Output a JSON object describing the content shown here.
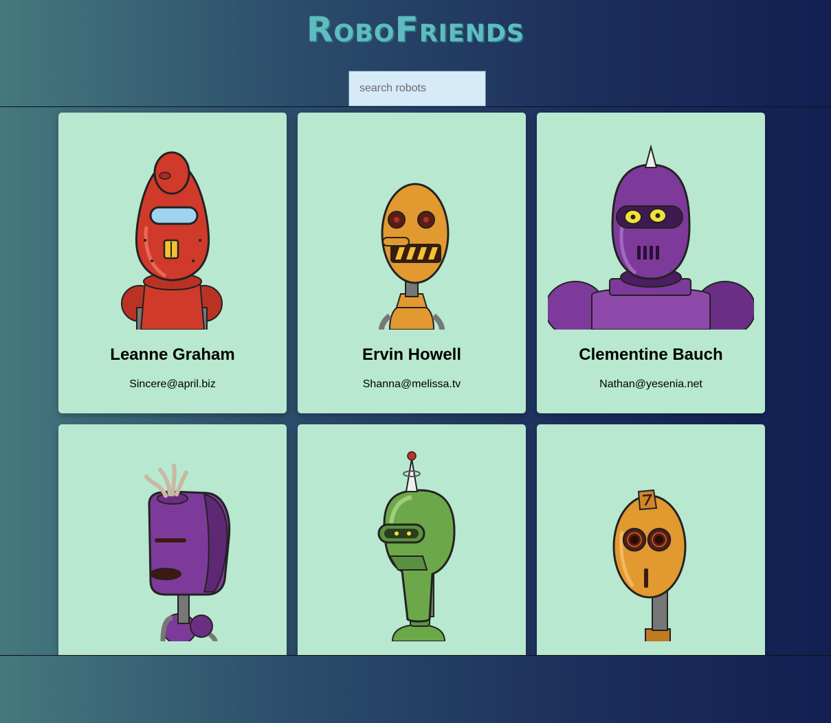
{
  "header": {
    "title": "RoboFriends"
  },
  "search": {
    "placeholder": "search robots",
    "value": ""
  },
  "robots": [
    {
      "name": "Leanne Graham",
      "email": "Sincere@april.biz",
      "color": "#d03a2a",
      "icon": "red-robot-avatar"
    },
    {
      "name": "Ervin Howell",
      "email": "Shanna@melissa.tv",
      "color": "#e2992f",
      "icon": "orange-robot-avatar"
    },
    {
      "name": "Clementine Bauch",
      "email": "Nathan@yesenia.net",
      "color": "#7e3a9a",
      "icon": "purple-robot-avatar"
    },
    {
      "name": "",
      "email": "",
      "color": "#7e3a9a",
      "icon": "purple-robot-avatar"
    },
    {
      "name": "",
      "email": "",
      "color": "#6ca84a",
      "icon": "green-robot-avatar"
    },
    {
      "name": "",
      "email": "",
      "color": "#e2992f",
      "icon": "orange-robot-avatar"
    }
  ]
}
